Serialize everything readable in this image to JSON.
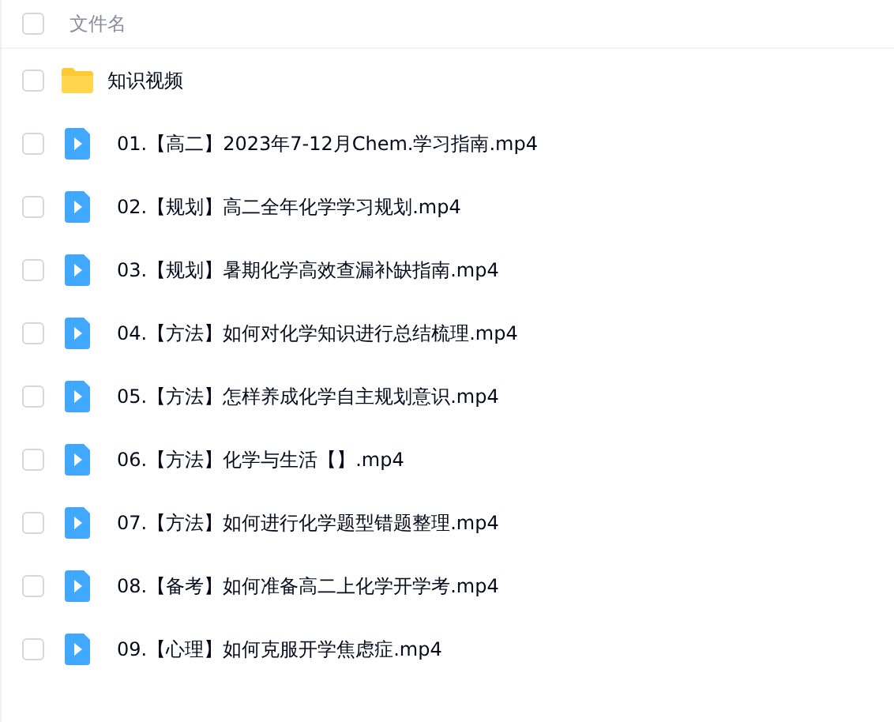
{
  "header": {
    "checked": false,
    "column_label": "文件名"
  },
  "files": [
    {
      "kind": "folder",
      "name": "知识视频",
      "checked": false
    },
    {
      "kind": "video",
      "name": "01.【高二】2023年7-12月Chem.学习指南.mp4",
      "checked": false
    },
    {
      "kind": "video",
      "name": "02.【规划】高二全年化学学习规划.mp4",
      "checked": false
    },
    {
      "kind": "video",
      "name": "03.【规划】暑期化学高效查漏补缺指南.mp4",
      "checked": false
    },
    {
      "kind": "video",
      "name": "04.【方法】如何对化学知识进行总结梳理.mp4",
      "checked": false
    },
    {
      "kind": "video",
      "name": "05.【方法】怎样养成化学自主规划意识.mp4",
      "checked": false
    },
    {
      "kind": "video",
      "name": "06.【方法】化学与生活【】.mp4",
      "checked": false
    },
    {
      "kind": "video",
      "name": "07.【方法】如何进行化学题型错题整理.mp4",
      "checked": false
    },
    {
      "kind": "video",
      "name": "08.【备考】如何准备高二上化学开学考.mp4",
      "checked": false
    },
    {
      "kind": "video",
      "name": "09.【心理】如何克服开学焦虑症.mp4",
      "checked": false
    }
  ]
}
